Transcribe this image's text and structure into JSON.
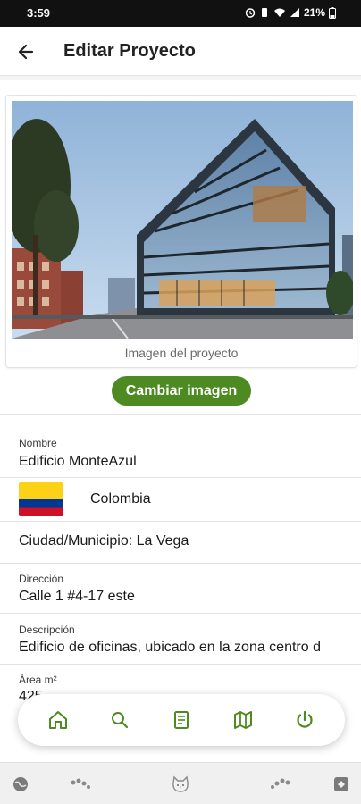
{
  "status_bar": {
    "time": "3:59",
    "battery": "21%"
  },
  "app_bar": {
    "title": "Editar Proyecto",
    "back_icon": "arrow-left-icon"
  },
  "image_card": {
    "caption": "Imagen del proyecto"
  },
  "change_image_button": "Cambiar imagen",
  "fields": {
    "nombre": {
      "label": "Nombre",
      "value": "Edificio MonteAzul"
    },
    "pais": {
      "value": "Colombia",
      "flag_icon": "colombia-flag-icon"
    },
    "ciudad": {
      "value": "Ciudad/Municipio: La Vega"
    },
    "direccion": {
      "label": "Dirección",
      "value": "Calle 1 #4-17 este"
    },
    "descripcion": {
      "label": "Descripción",
      "value": "Edificio de oficinas, ubicado en la zona centro d"
    },
    "area": {
      "label": "Área m²",
      "value": "425"
    }
  },
  "bottom_nav": {
    "items": [
      "home-icon",
      "search-icon",
      "document-icon",
      "map-icon",
      "power-icon"
    ],
    "accent_color": "#4d8a21"
  },
  "colors": {
    "primary_green": "#4d8a21",
    "status_bar": "#111111"
  }
}
